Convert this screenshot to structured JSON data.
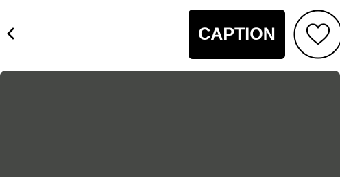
{
  "header": {
    "back_icon": "chevron-left-icon",
    "caption_label": "CAPTION",
    "like_icon": "heart-outline-icon"
  },
  "colors": {
    "background": "#ffffff",
    "caption_button_bg": "#000000",
    "caption_button_text": "#ffffff",
    "media_area": "#464845",
    "icon_stroke": "#000000"
  }
}
